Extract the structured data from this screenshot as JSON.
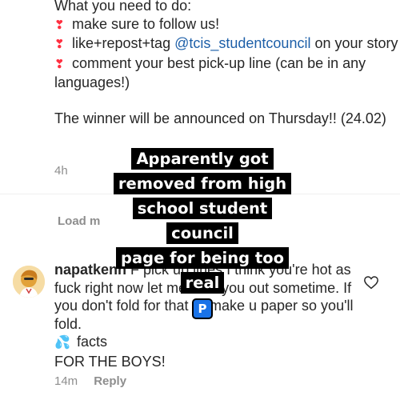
{
  "caption": {
    "heading": "What you need to do:",
    "item1": "make sure to follow us!",
    "item2_pre": "like+repost+tag ",
    "item2_mention": "@tcis_studentcouncil",
    "item2_post": " on your story",
    "item3": "comment your best pick-up line (can be in any languages!)",
    "announce": "The winner will be announced on Thursday!! (24.02)",
    "bullet_icon": "red-exclamation-heart-icon",
    "time": "4h"
  },
  "load_more": "Load m",
  "overlay": {
    "lines": [
      "Apparently got",
      "removed from high",
      "school student council",
      "page for being too real"
    ],
    "badge": "P"
  },
  "comment": {
    "username": "napatkenn",
    "text": "F pick up lines I think you're hot as fuck right now let me take you out sometime. If you don't fold for that I'll make u paper so you'll fold.",
    "drop_icon": "sweat-droplets-icon",
    "line2": "facts",
    "line3": "FOR THE BOYS!",
    "time": "14m",
    "reply": "Reply"
  },
  "colors": {
    "mention": "#1d5fa8",
    "muted": "#8e8e8e",
    "heart": "#ff3040",
    "overlay_bg": "#000000",
    "badge": "#1a73e8"
  }
}
